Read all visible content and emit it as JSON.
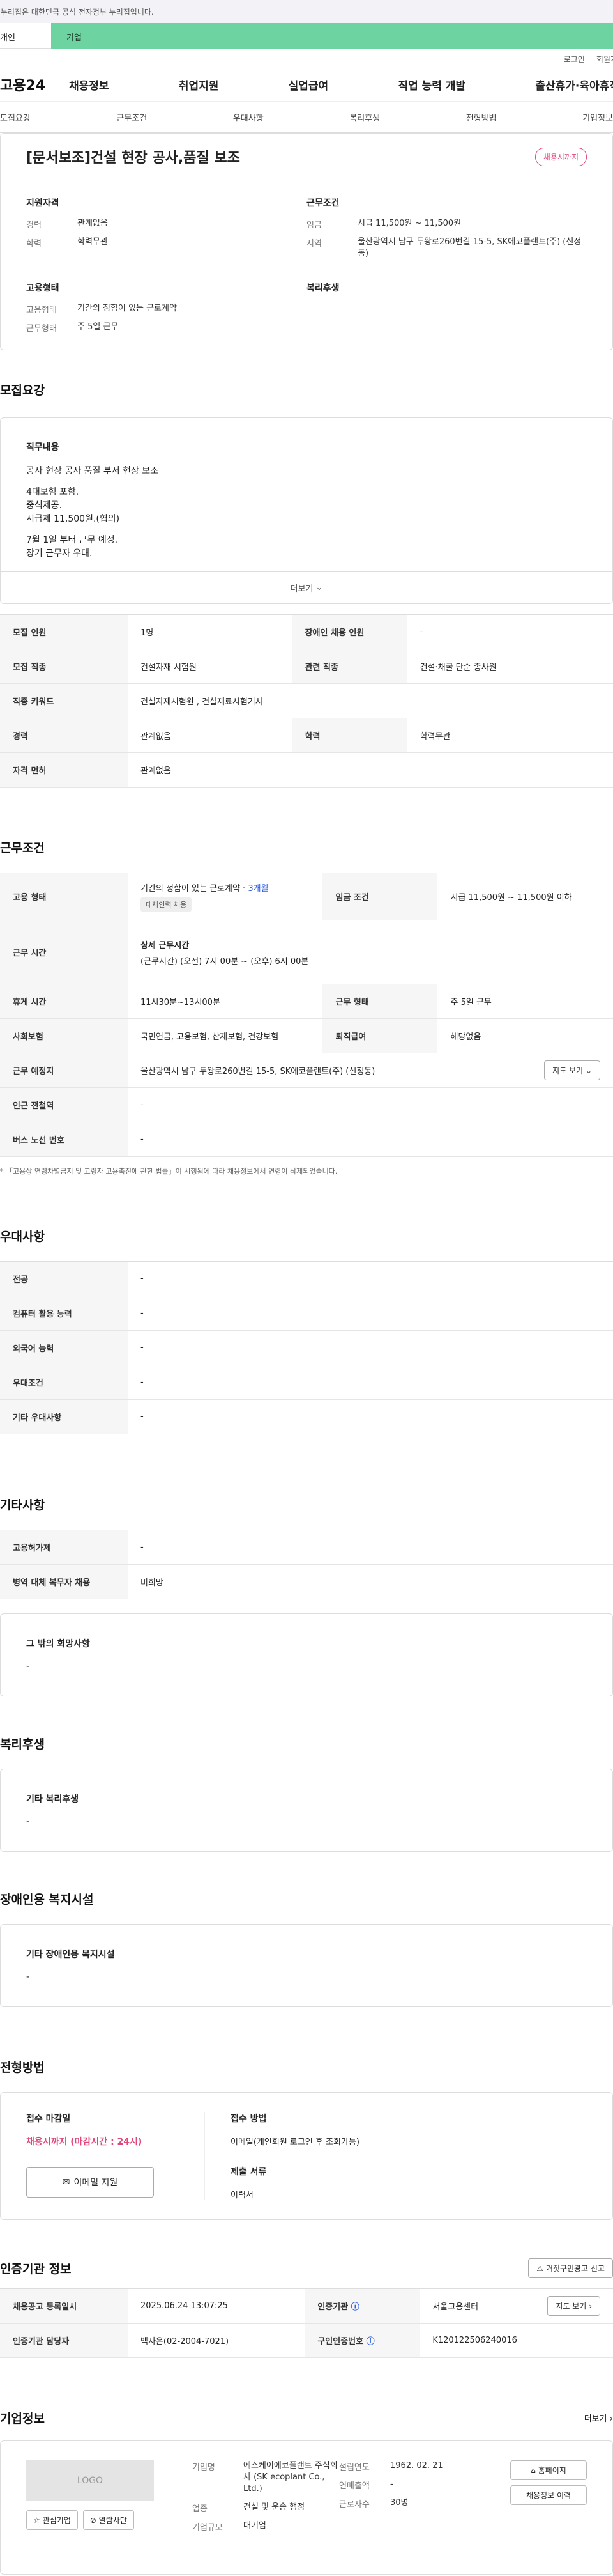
{
  "notice": "이 누리집은 대한민국 공식 전자정부 누리집입니다.",
  "tabs": [
    "개인",
    "기업"
  ],
  "util": [
    "로그인",
    "회원가입"
  ],
  "logo": "고용24",
  "gnb": [
    "채용정보",
    "취업지원",
    "실업급여",
    "직업 능력 개발",
    "출산휴가·육아휴직"
  ],
  "subnav": [
    "모집요강",
    "근무조건",
    "우대사항",
    "복리후생",
    "전형방법",
    "기업정보"
  ],
  "summary": {
    "title": "[문서보조]건설 현장 공사,품질 보조",
    "badge": "채용시까지",
    "qual_title": "지원자격",
    "qual": [
      {
        "k": "경력",
        "v": "관계없음"
      },
      {
        "k": "학력",
        "v": "학력무관"
      }
    ],
    "cond_title": "근무조건",
    "cond": [
      {
        "k": "임금",
        "v": "시급 11,500원 ~ 11,500원"
      },
      {
        "k": "지역",
        "v": "울산광역시 남구 두왕로260번길 15-5, SK에코플랜트(주) (신정동)"
      }
    ],
    "emp_title": "고용형태",
    "emp": [
      {
        "k": "고용형태",
        "v": "기간의 정함이 있는 근로계약"
      },
      {
        "k": "근무형태",
        "v": "주 5일 근무"
      }
    ],
    "welfare_title": "복리후생"
  },
  "recruit": {
    "title": "모집요강",
    "job_title": "직무내용",
    "job_lines": [
      "공사 현장 공사 품질 부서 현장 보조",
      "",
      "4대보험 포함.",
      "중식제공.",
      "시급제 11,500원.(협의)",
      "",
      "7월 1일 부터 근무 예정.",
      "장기 근무자 우대."
    ],
    "more": "더보기",
    "rows": [
      [
        "모집 인원",
        "1명",
        "장애인 채용 인원",
        "-"
      ],
      [
        "모집 직종",
        "건설자재 시험원",
        "관련 직종",
        "건설·채굴 단순 종사원"
      ],
      [
        "직종 키워드",
        "건설자재시험원 , 건설재료시험기사"
      ],
      [
        "경력",
        "관계없음",
        "학력",
        "학력무관"
      ],
      [
        "자격 면허",
        "관계없음"
      ]
    ]
  },
  "conditions": {
    "title": "근무조건",
    "emp_label": "고용 형태",
    "emp_value": "기간의 정함이 있는 근로계약",
    "emp_period": "3개월",
    "emp_chip": "대체인력 채용",
    "wage_label": "임금 조건",
    "wage_value": "시급 11,500원 ~ 11,500원 이하",
    "time_label": "근무 시간",
    "time_head": "상세 근무시간",
    "time_value": "(근무시간) (오전) 7시 00분 ~ (오후) 6시 00분",
    "rest_label": "휴게 시간",
    "rest_value": "11시30분~13시00분",
    "type_label": "근무 형태",
    "type_value": "주 5일 근무",
    "ins_label": "사회보험",
    "ins_value": "국민연금, 고용보험, 산재보험, 건강보험",
    "sev_label": "퇴직급여",
    "sev_value": "해당없음",
    "place_label": "근무 예정지",
    "place_value": "울산광역시 남구 두왕로260번길 15-5, SK에코플랜트(주) (신정동)",
    "map_btn": "지도 보기",
    "subway_label": "인근 전철역",
    "subway_value": "-",
    "bus_label": "버스 노선 번호",
    "bus_value": "-",
    "note": "* 「고용상 연령차별금지 및 고령자 고용촉진에 관한 법률」이 시행됨에 따라 채용정보에서 연령이 삭제되었습니다."
  },
  "pref": {
    "title": "우대사항",
    "rows": [
      [
        "전공",
        "-"
      ],
      [
        "컴퓨터 활용 능력",
        "-"
      ],
      [
        "외국어 능력",
        "-"
      ],
      [
        "우대조건",
        "-"
      ],
      [
        "기타 우대사항",
        "-"
      ]
    ]
  },
  "etc": {
    "title": "기타사항",
    "rows": [
      [
        "고용허가제",
        "-"
      ],
      [
        "병역 대체 복무자 채용",
        "비희망"
      ]
    ],
    "other_title": "그 밖의 희망사항",
    "other_value": "-"
  },
  "welfare": {
    "title": "복리후생",
    "sub": "기타 복리후생",
    "value": "-"
  },
  "disab": {
    "title": "장애인용 복지시설",
    "sub": "기타 장애인용 복지시설",
    "value": "-"
  },
  "process": {
    "title": "전형방법",
    "deadline_label": "접수 마감일",
    "deadline_value": "채용시까지 (마감시간 : 24시)",
    "email_btn": "이메일 지원",
    "method_label": "접수 방법",
    "method_value": "이메일(개인회원 로그인 후 조회가능)",
    "docs_label": "제출 서류",
    "docs_value": "이력서"
  },
  "auth": {
    "title": "인증기관 정보",
    "report_btn": "거짓구인광고 신고",
    "rows": [
      [
        "채용공고 등록일시",
        "2025.06.24 13:07:25",
        "인증기관",
        "서울고용센터"
      ],
      [
        "인증기관 담당자",
        "백자은(02-2004-7021)",
        "구인인증번호",
        "K120122506240016"
      ]
    ],
    "map_btn": "지도 보기"
  },
  "company": {
    "title": "기업정보",
    "more": "더보기",
    "logo": "LOGO",
    "fav": "관심기업",
    "block": "열람차단",
    "name_label": "기업명",
    "name_value": "에스케이에코플랜트 주식회사 (SK ecoplant Co., Ltd.)",
    "ind_label": "업종",
    "ind_value": "건설 및 운송 행정",
    "size_label": "기업규모",
    "size_value": "대기업",
    "year_label": "설립연도",
    "year_value": "1962. 02. 21",
    "sales_label": "연매출액",
    "sales_value": "-",
    "emp_label": "근로자수",
    "emp_value": "30명",
    "homepage": "홈페이지",
    "history": "채용정보 이력"
  }
}
